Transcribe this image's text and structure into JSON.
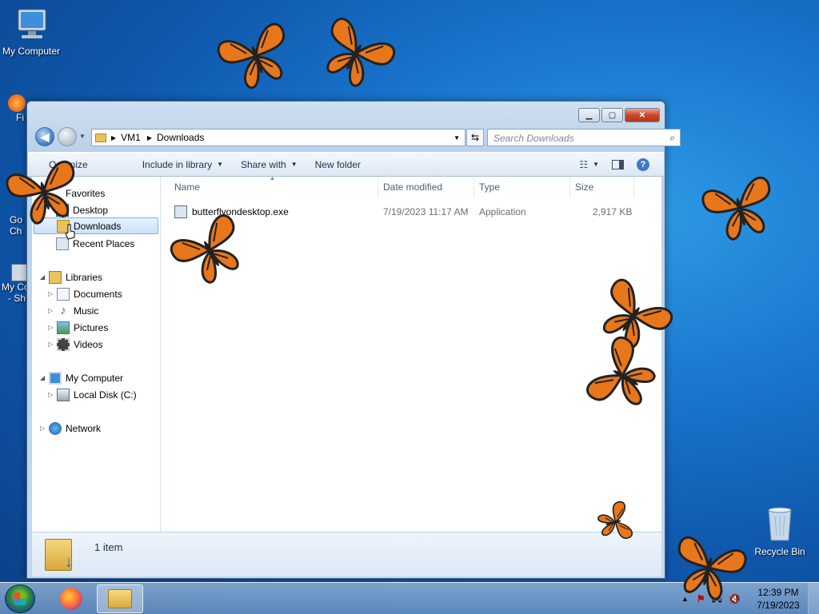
{
  "desktop": {
    "icons": [
      {
        "label": "My Computer",
        "icon": "monitor-icon"
      },
      {
        "label": "Recycle Bin",
        "icon": "recycle-bin-icon"
      }
    ],
    "partial_labels": [
      "Fi",
      "Go",
      "Ch",
      "My Co",
      "- Sh"
    ]
  },
  "window": {
    "path": [
      "VM1",
      "Downloads"
    ],
    "search_placeholder": "Search Downloads",
    "toolbar": {
      "organize": "Organize",
      "include": "Include in library",
      "share": "Share with",
      "new_folder": "New folder"
    },
    "nav": {
      "favorites": "Favorites",
      "desktop": "Desktop",
      "downloads": "Downloads",
      "recent": "Recent Places",
      "libraries": "Libraries",
      "documents": "Documents",
      "music": "Music",
      "pictures": "Pictures",
      "videos": "Videos",
      "computer": "My Computer",
      "local_disk": "Local Disk (C:)",
      "network": "Network"
    },
    "columns": {
      "name": "Name",
      "date": "Date modified",
      "type": "Type",
      "size": "Size"
    },
    "files": [
      {
        "name": "butterflyondesktop.exe",
        "date": "7/19/2023 11:17 AM",
        "type": "Application",
        "size": "2,917 KB"
      }
    ],
    "status": "1 item"
  },
  "taskbar": {
    "time": "12:39 PM",
    "date": "7/19/2023"
  },
  "colors": {
    "accent": "#1a78cf",
    "butterfly": "#e8761b"
  }
}
